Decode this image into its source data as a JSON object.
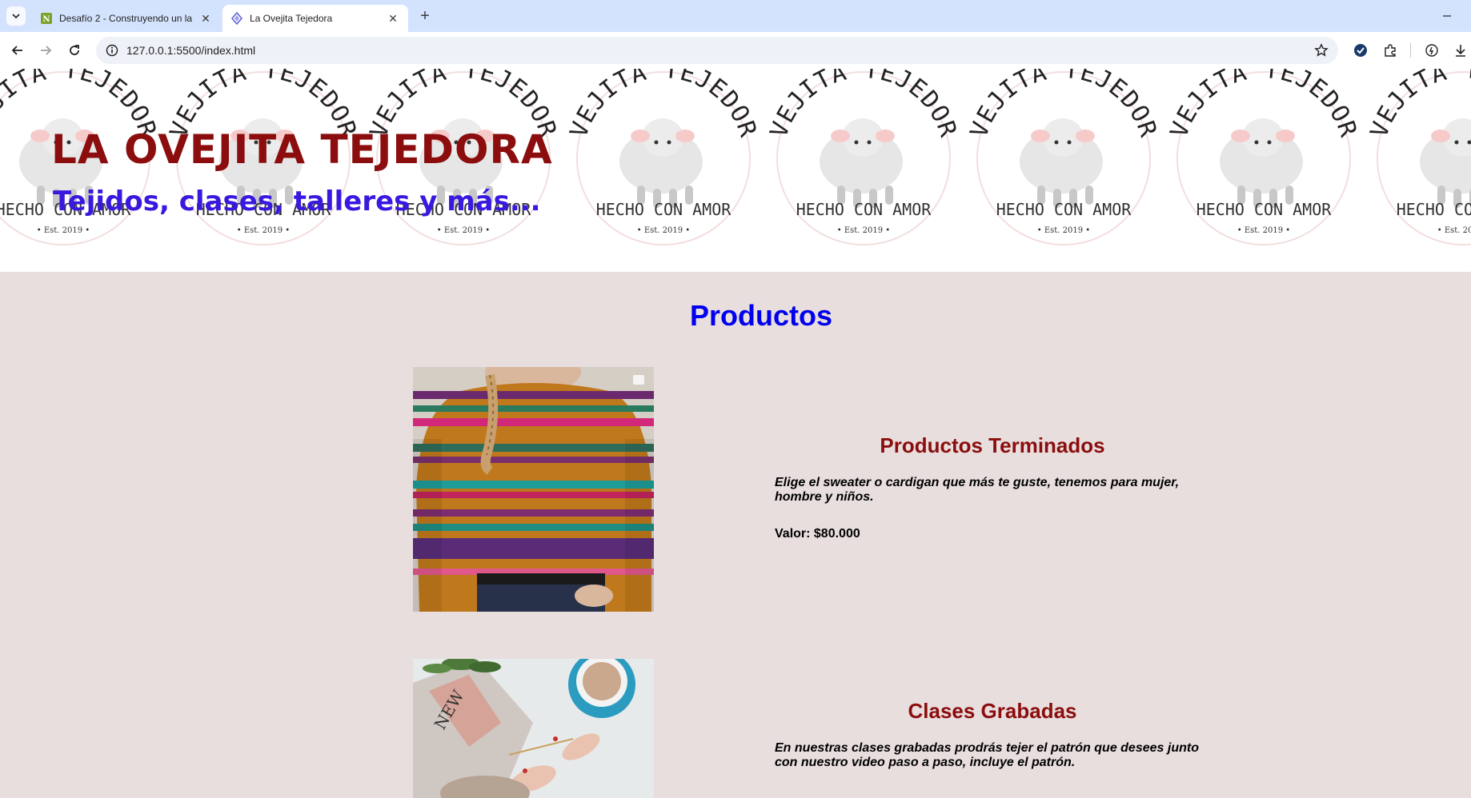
{
  "browser": {
    "tabs": [
      {
        "title": "Desafío 2 - Construyendo un la",
        "favicon": "notion-icon",
        "active": false
      },
      {
        "title": "La Ovejita Tejedora",
        "favicon": "bolt-icon",
        "active": true
      }
    ],
    "url": "127.0.0.1:5500/index.html",
    "tab_close_glyph": "✕",
    "new_tab_glyph": "+"
  },
  "header": {
    "title": "LA OVEJITA TEJEDORA",
    "subtitle": "Tejidos, clases, talleres y más...",
    "banner_logo": {
      "arc_text": "OVEJITA TEJEDORA",
      "tagline": "HECHO CON AMOR",
      "est": "• Est. 2019 •"
    }
  },
  "main": {
    "section_title": "Productos",
    "products": [
      {
        "name": "Productos Terminados",
        "description": "Elige el sweater o cardigan que más te guste, tenemos para mujer, hombre y niños.",
        "price": "Valor: $80.000",
        "image": "striped-sweater-photo"
      },
      {
        "name": "Clases Grabadas",
        "description": "En nuestras clases grabadas prodrás tejer el patrón que desees junto con nuestro video paso a paso, incluye el patrón.",
        "price": "",
        "image": "knitting-hands-photo"
      }
    ]
  },
  "colors": {
    "page_bg": "#e8dede",
    "title_red": "#8b0d0d",
    "subtitle_blue": "#3a18e0",
    "section_blue": "#0000ee",
    "tabbar": "#d3e3fd"
  }
}
